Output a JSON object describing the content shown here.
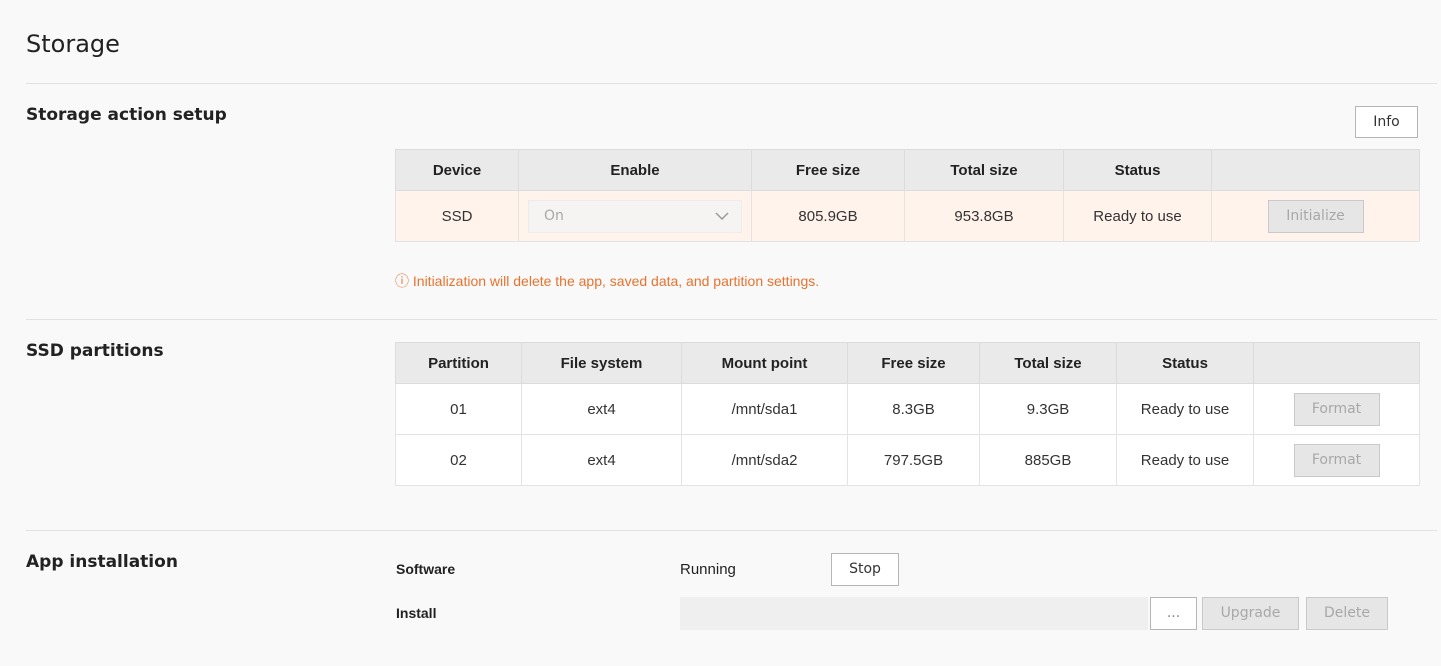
{
  "page": {
    "title": "Storage"
  },
  "storage_action": {
    "title": "Storage action setup",
    "info_label": "Info",
    "columns": [
      "Device",
      "Enable",
      "Free size",
      "Total size",
      "Status",
      ""
    ],
    "row": {
      "device": "SSD",
      "enable": "On",
      "free_size": "805.9GB",
      "total_size": "953.8GB",
      "status": "Ready to use",
      "action": "Initialize"
    },
    "warning": "ⓘ Initialization will delete the app, saved data, and partition settings."
  },
  "partitions": {
    "title": "SSD partitions",
    "columns": [
      "Partition",
      "File system",
      "Mount point",
      "Free size",
      "Total size",
      "Status",
      ""
    ],
    "rows": [
      {
        "partition": "01",
        "fs": "ext4",
        "mount": "/mnt/sda1",
        "free": "8.3GB",
        "total": "9.3GB",
        "status": "Ready to use",
        "action": "Format"
      },
      {
        "partition": "02",
        "fs": "ext4",
        "mount": "/mnt/sda2",
        "free": "797.5GB",
        "total": "885GB",
        "status": "Ready to use",
        "action": "Format"
      }
    ]
  },
  "app": {
    "title": "App installation",
    "software_label": "Software",
    "software_state": "Running",
    "stop_label": "Stop",
    "install_label": "Install",
    "browse_label": "...",
    "upgrade_label": "Upgrade",
    "delete_label": "Delete",
    "file_value": ""
  },
  "colors": {
    "status_ok": "#1a1ad6",
    "warning": "#e8722f",
    "highlight_row": "#fff3ec"
  }
}
